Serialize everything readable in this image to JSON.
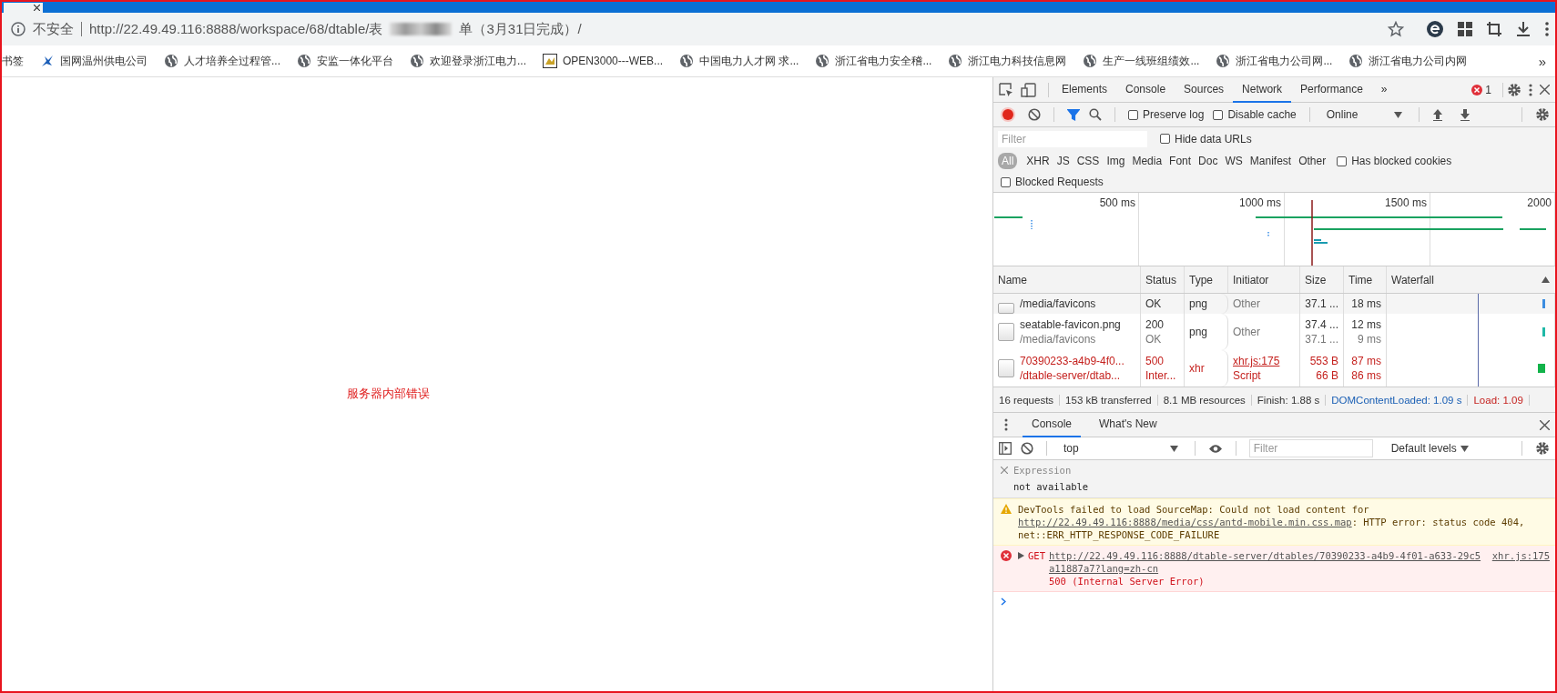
{
  "address_bar": {
    "security_label": "不安全",
    "url_start": "http://22.49.49.116:8888/workspace/68/dtable/表",
    "url_end": "单（3月31日完成）/"
  },
  "bookmarks": {
    "label": "书签",
    "items": [
      {
        "kind": "logo",
        "title": "国网温州供电公司"
      },
      {
        "kind": "site",
        "title": "人才培养全过程管..."
      },
      {
        "kind": "site",
        "title": "安监一体化平台"
      },
      {
        "kind": "site",
        "title": "欢迎登录浙江电力..."
      },
      {
        "kind": "picture",
        "title": "OPEN3000---WEB..."
      },
      {
        "kind": "site",
        "title": "中国电力人才网 求..."
      },
      {
        "kind": "site",
        "title": "浙江省电力安全稽..."
      },
      {
        "kind": "site",
        "title": "浙江电力科技信息网"
      },
      {
        "kind": "site",
        "title": "生产一线班组绩效..."
      },
      {
        "kind": "site",
        "title": "浙江省电力公司网..."
      },
      {
        "kind": "site",
        "title": "浙江省电力公司内网"
      }
    ],
    "overflow": "»"
  },
  "page": {
    "error_message": "服务器内部错误"
  },
  "devtools": {
    "tabs": [
      {
        "label": "Elements",
        "selected": false
      },
      {
        "label": "Console",
        "selected": false
      },
      {
        "label": "Sources",
        "selected": false
      },
      {
        "label": "Network",
        "selected": true
      },
      {
        "label": "Performance",
        "selected": false
      }
    ],
    "more": "»",
    "error_count": "1",
    "network_toolbar": {
      "recording": true,
      "filter_active": true,
      "throttling": "Online",
      "checkboxes": [
        {
          "label": "Preserve log",
          "checked": false
        },
        {
          "label": "Disable cache",
          "checked": false
        }
      ]
    },
    "filter": {
      "placeholder": "Filter",
      "hide_data_urls": {
        "label": "Hide data URLs",
        "checked": false
      }
    },
    "type_filters": [
      {
        "label": "All",
        "selected": true
      },
      {
        "label": "XHR",
        "selected": false
      },
      {
        "label": "JS",
        "selected": false
      },
      {
        "label": "CSS",
        "selected": false
      },
      {
        "label": "Img",
        "selected": false
      },
      {
        "label": "Media",
        "selected": false
      },
      {
        "label": "Font",
        "selected": false
      },
      {
        "label": "Doc",
        "selected": false
      },
      {
        "label": "WS",
        "selected": false
      },
      {
        "label": "Manifest",
        "selected": false
      },
      {
        "label": "Other",
        "selected": false
      }
    ],
    "has_blocked_cookies": {
      "label": "Has blocked cookies",
      "checked": false
    },
    "blocked_requests": {
      "label": "Blocked Requests",
      "checked": false
    },
    "overview": {
      "tick_labels": [
        "500 ms",
        "1000 ms",
        "1500 ms",
        "2000"
      ]
    },
    "requests": {
      "columns": [
        "Name",
        "Status",
        "Type",
        "Initiator",
        "Size",
        "Time",
        "Waterfall"
      ],
      "rows": [
        {
          "error": false,
          "clipped": true,
          "initiator_is_link": false,
          "name": [
            "/media/favicons"
          ],
          "status": [
            "OK"
          ],
          "type": [
            "png"
          ],
          "initiator": [
            "Other"
          ],
          "size": [
            "37.1 ..."
          ],
          "time": [
            "18 ms"
          ]
        },
        {
          "error": false,
          "clipped": false,
          "initiator_is_link": false,
          "name": [
            "seatable-favicon.png",
            "/media/favicons"
          ],
          "status": [
            "200",
            "OK"
          ],
          "type": [
            "png"
          ],
          "initiator": [
            "Other"
          ],
          "size": [
            "37.4 ...",
            "37.1 ..."
          ],
          "time": [
            "12 ms",
            "9 ms"
          ]
        },
        {
          "error": true,
          "clipped": false,
          "initiator_is_link": true,
          "name": [
            "70390233-a4b9-4f0...",
            "/dtable-server/dtab..."
          ],
          "status": [
            "500",
            "Inter..."
          ],
          "type": [
            "xhr"
          ],
          "initiator": [
            "xhr.js:175",
            "Script"
          ],
          "size": [
            "553 B",
            "66 B"
          ],
          "time": [
            "87 ms",
            "86 ms"
          ]
        }
      ]
    },
    "summary": [
      {
        "text": "16 requests",
        "color": "#333333"
      },
      {
        "text": "153 kB transferred",
        "color": "#333333"
      },
      {
        "text": "8.1 MB resources",
        "color": "#333333"
      },
      {
        "text": "Finish: 1.88 s",
        "color": "#333333"
      },
      {
        "text": "DOMContentLoaded: 1.09 s",
        "color": "#1a5fb4"
      },
      {
        "text": "Load: 1.09",
        "color": "#c5221f"
      }
    ],
    "drawer": {
      "tabs": [
        {
          "label": "Console",
          "selected": true
        },
        {
          "label": "What's New",
          "selected": false
        }
      ],
      "context": "top",
      "filter_placeholder": "Filter",
      "levels": "Default levels"
    },
    "console": {
      "expression": {
        "label": "Expression",
        "value": "not available"
      },
      "messages": [
        {
          "kind": "warning",
          "text_before": "DevTools failed to load SourceMap: Could not load content for ",
          "link": "http://22.49.49.116:8888/media/css/antd-mobile.min.css.map",
          "text_after": ": HTTP error: status code 404, net::ERR_HTTP_RESPONSE_CODE_FAILURE"
        },
        {
          "kind": "error",
          "method": "GET",
          "link": "http://22.49.49.116:8888/dtable-server/dtables/70390233-a4b9-4f01-a633-29c5a11887a7?lang=zh-cn",
          "text_after": "500 (Internal Server Error)",
          "source": "xhr.js:175"
        }
      ]
    }
  }
}
